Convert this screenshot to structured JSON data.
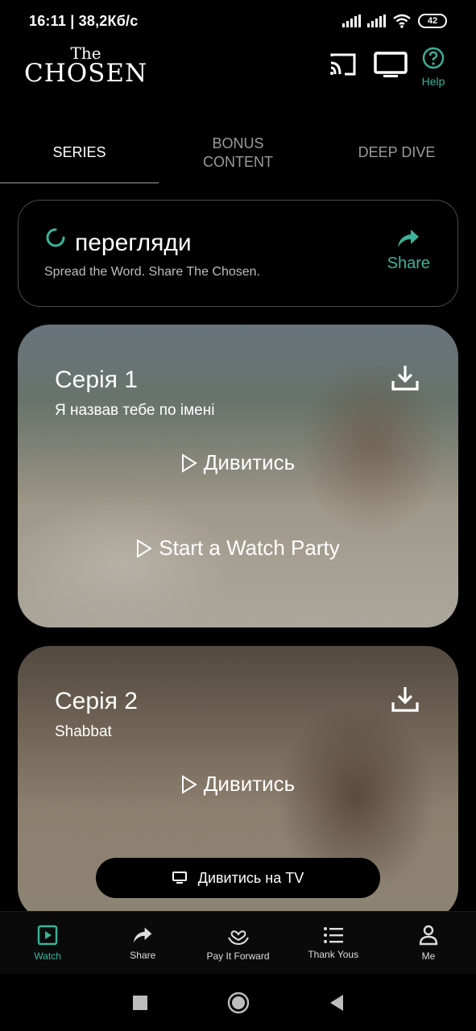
{
  "status_bar": {
    "time": "16:11 | 38,2Кб/с",
    "battery": "42"
  },
  "header": {
    "logo_the": "The",
    "logo_chosen": "CHOSEN",
    "cast_icon": "cast-icon",
    "tv_icon": "tv-icon",
    "help_label": "Help"
  },
  "tabs": [
    {
      "label": "SERIES",
      "active": true
    },
    {
      "label": "BONUS CONTENT",
      "active": false
    },
    {
      "label": "DEEP DIVE",
      "active": false
    }
  ],
  "share_card": {
    "title": "перегляди",
    "subtitle": "Spread the Word. Share The Chosen.",
    "action_label": "Share"
  },
  "episodes": [
    {
      "title": "Серія 1",
      "subtitle": "Я назвав тебе по імені",
      "watch_label": "Дивитись",
      "party_label": "Start a Watch Party"
    },
    {
      "title": "Серія 2",
      "subtitle": "Shabbat",
      "watch_label": "Дивитись",
      "tv_label": "Дивитись на TV"
    }
  ],
  "bottom_nav": [
    {
      "label": "Watch",
      "icon": "play-square-icon",
      "active": true
    },
    {
      "label": "Share",
      "icon": "share-arrow-icon",
      "active": false
    },
    {
      "label": "Pay It Forward",
      "icon": "heart-hands-icon",
      "active": false
    },
    {
      "label": "Thank Yous",
      "icon": "list-icon",
      "active": false
    },
    {
      "label": "Me",
      "icon": "person-icon",
      "active": false
    }
  ],
  "colors": {
    "accent": "#3bb39a",
    "background": "#000000"
  }
}
